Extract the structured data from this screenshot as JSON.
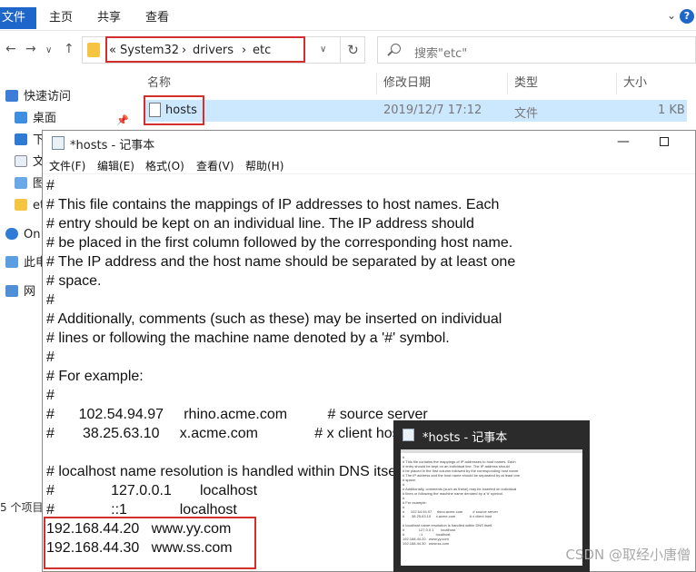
{
  "explorer": {
    "ribbon_tabs": [
      "文件",
      "主页",
      "共享",
      "查看"
    ],
    "address_path": [
      "System32",
      "drivers",
      "etc"
    ],
    "search_placeholder": "搜索\"etc\"",
    "columns": [
      "名称",
      "修改日期",
      "类型",
      "大小"
    ],
    "file": {
      "name": "hosts",
      "modified": "2019/12/7 17:12",
      "type": "文件",
      "size": "1 KB"
    },
    "sidebar": [
      "快速访问",
      "桌面",
      "下",
      "文",
      "图",
      "et",
      "On",
      "此电",
      "网"
    ],
    "status_count": "5 个项目"
  },
  "notepad": {
    "title": "*hosts - 记事本",
    "menu": [
      "文件(F)",
      "编辑(E)",
      "格式(O)",
      "查看(V)",
      "帮助(H)"
    ],
    "lines": [
      "#",
      "# This file contains the mappings of IP addresses to host names. Each",
      "# entry should be kept on an individual line. The IP address should",
      "# be placed in the first column followed by the corresponding host name.",
      "# The IP address and the host name should be separated by at least one",
      "# space.",
      "#",
      "# Additionally, comments (such as these) may be inserted on individual",
      "# lines or following the machine name denoted by a '#' symbol.",
      "#",
      "# For example:",
      "#",
      "#      102.54.94.97     rhino.acme.com          # source server",
      "#       38.25.63.10     x.acme.com              # x client host",
      "",
      "# localhost name resolution is handled within DNS itself.",
      "#              127.0.0.1       localhost",
      "#              ::1             localhost",
      "192.168.44.20   www.yy.com",
      "192.168.44.30   www.ss.com"
    ]
  },
  "preview": {
    "title": "*hosts - 记事本"
  },
  "watermark": "CSDN @取经小唐僧"
}
